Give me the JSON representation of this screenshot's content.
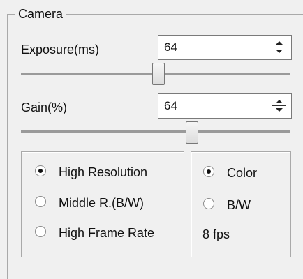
{
  "camera": {
    "group_title": "Camera",
    "exposure": {
      "label": "Exposure(ms)",
      "value": "64",
      "slider_fraction": 0.51
    },
    "gain": {
      "label": "Gain(%)",
      "value": "64",
      "slider_fraction": 0.64
    },
    "resolution_options": [
      {
        "label": "High Resolution",
        "selected": true
      },
      {
        "label": "Middle R.(B/W)",
        "selected": false
      },
      {
        "label": "High Frame Rate",
        "selected": false
      }
    ],
    "color_options": [
      {
        "label": "Color",
        "selected": true
      },
      {
        "label": "B/W",
        "selected": false
      }
    ],
    "fps_text": "8 fps"
  }
}
